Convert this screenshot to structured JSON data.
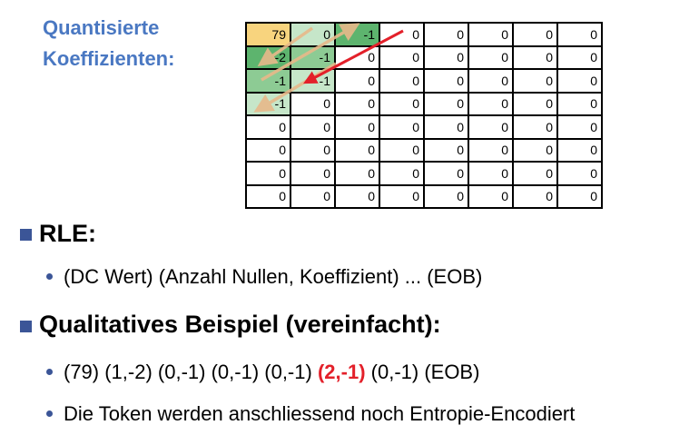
{
  "heading": {
    "line1": "Quantisierte",
    "line2": "Koeffizienten:"
  },
  "matrix": [
    [
      "79",
      "0",
      "-1",
      "0",
      "0",
      "0",
      "0",
      "0"
    ],
    [
      "-2",
      "-1",
      "0",
      "0",
      "0",
      "0",
      "0",
      "0"
    ],
    [
      "-1",
      "-1",
      "0",
      "0",
      "0",
      "0",
      "0",
      "0"
    ],
    [
      "-1",
      "0",
      "0",
      "0",
      "0",
      "0",
      "0",
      "0"
    ],
    [
      "0",
      "0",
      "0",
      "0",
      "0",
      "0",
      "0",
      "0"
    ],
    [
      "0",
      "0",
      "0",
      "0",
      "0",
      "0",
      "0",
      "0"
    ],
    [
      "0",
      "0",
      "0",
      "0",
      "0",
      "0",
      "0",
      "0"
    ],
    [
      "0",
      "0",
      "0",
      "0",
      "0",
      "0",
      "0",
      "0"
    ]
  ],
  "colors": {
    "heading": "#4a78c2",
    "bullet": "#3b5597",
    "highlight_red": "#e3202a",
    "cell_dc": "#f8d47e",
    "cell_dark_green": "#5db46e",
    "cell_mid_green": "#8dcb94",
    "cell_light_green": "#c6e6c9",
    "arrow_tan": "#e8b98a",
    "arrow_red": "#e3202a"
  },
  "section_rle": {
    "title": "RLE:",
    "item": "(DC Wert) (Anzahl Nullen, Koeffizient) ... (EOB)"
  },
  "section_example": {
    "title": "Qualitatives Beispiel (vereinfacht):",
    "example_pre": "(79) (1,-2) (0,-1) (0,-1) (0,-1)",
    "example_highlight": "(2,-1)",
    "example_post": "(0,-1) (EOB)",
    "note": "Die Token werden anschliessend noch Entropie-Encodiert"
  }
}
